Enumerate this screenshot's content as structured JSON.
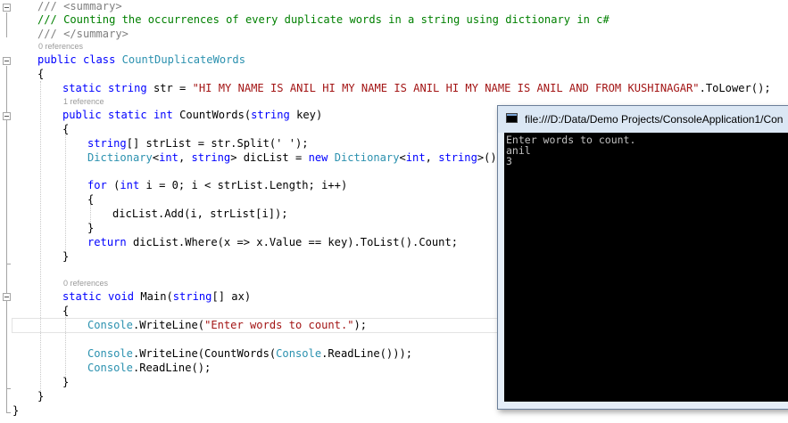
{
  "editor": {
    "code_lens": {
      "class_refs": "0 references",
      "field_refs": "1 reference",
      "main_refs": "0 references"
    },
    "lines": {
      "summary_open": "/// <summary>",
      "summary_text": "/// Counting the occurrences of every duplicate words in a string using dictionary in c#",
      "summary_close": "/// </summary>",
      "class_kw1": "public",
      "class_kw2": "class",
      "class_name": "CountDuplicateWords",
      "brace_open": "{",
      "brace_close": "}",
      "field_kw1": "static",
      "field_kw2": "string",
      "field_name": "str = ",
      "field_value": "\"HI MY NAME IS ANIL HI MY NAME IS ANIL HI MY NAME IS ANIL AND FROM KUSHINAGAR\"",
      "field_tail": ".ToLower();",
      "method_kw1": "public",
      "method_kw2": "static",
      "method_kw3": "int",
      "method_name": "CountWords(",
      "method_kw4": "string",
      "method_tail": "key)",
      "split_kw": "string",
      "split_tail": "[] strList = str.Split(' ');",
      "dict_type": "Dictionary",
      "dict_a": "<",
      "dict_kw1": "int",
      "dict_b": ", ",
      "dict_kw2": "string",
      "dict_c": "> dicList = ",
      "dict_new": "new",
      "dict_type2": "Dictionary",
      "dict_d": "<",
      "dict_kw3": "int",
      "dict_e": ", ",
      "dict_kw4": "string",
      "dict_f": ">();",
      "for_kw": "for",
      "for_a": " (",
      "for_int": "int",
      "for_tail": " i = 0; i < strList.Length; i++)",
      "add_stmt": "dicList.Add(i, strList[i]);",
      "return_kw": "return",
      "return_tail": " dicList.Where(x => x.Value == key).ToList().Count;",
      "main_kw1": "static",
      "main_kw2": "void",
      "main_name": " Main(",
      "main_kw3": "string",
      "main_tail": "[] ax)",
      "console_type": "Console",
      "writeline1_a": ".WriteLine(",
      "writeline1_str": "\"Enter words to count.\"",
      "writeline1_b": ");",
      "writeline2_a": ".WriteLine(CountWords(",
      "console_type2": "Console",
      "writeline2_b": ".ReadLine()));",
      "readline": ".ReadLine();"
    }
  },
  "console_window": {
    "title": "file:///D:/Data/Demo Projects/ConsoleApplication1/Con",
    "output": [
      "Enter words to count.",
      "anil",
      "3"
    ]
  }
}
